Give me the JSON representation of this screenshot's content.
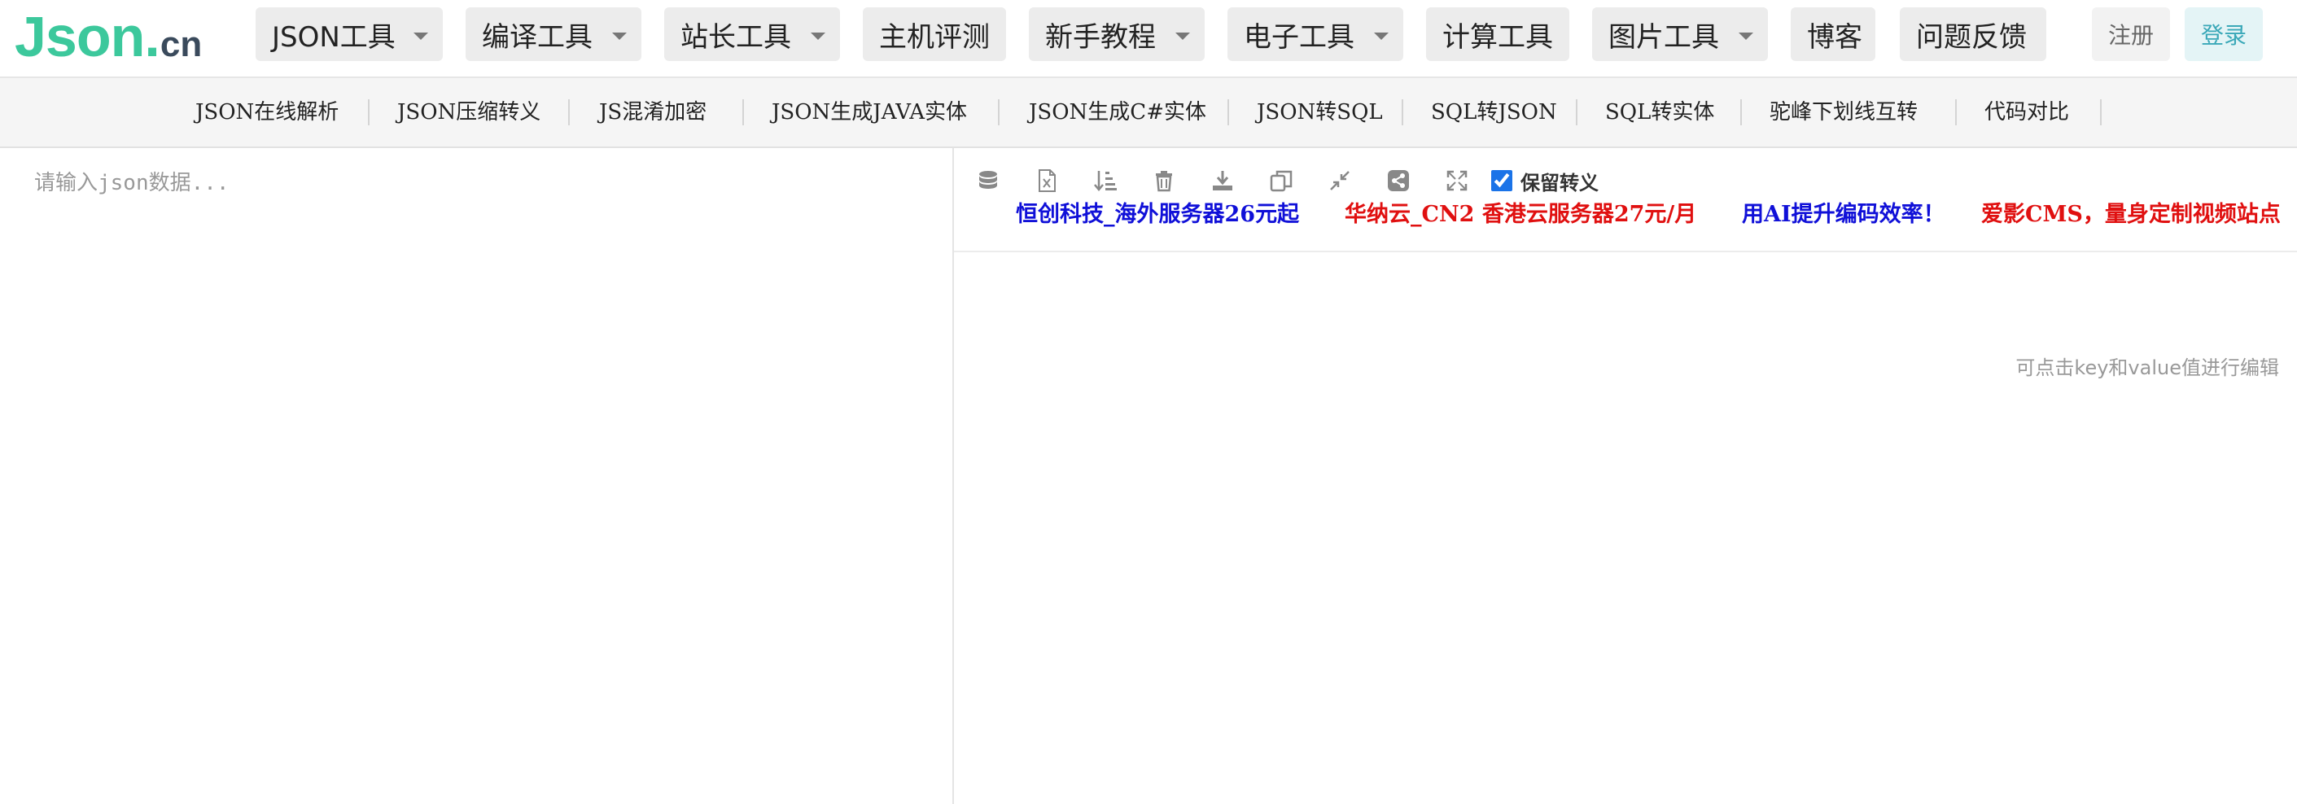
{
  "logo": {
    "main": "Json",
    "dot": ".",
    "suffix": "cn"
  },
  "nav": {
    "items": [
      {
        "label": "JSON工具",
        "dropdown": true
      },
      {
        "label": "编译工具",
        "dropdown": true
      },
      {
        "label": "站长工具",
        "dropdown": true
      },
      {
        "label": "主机评测",
        "dropdown": false
      },
      {
        "label": "新手教程",
        "dropdown": true
      },
      {
        "label": "电子工具",
        "dropdown": true
      },
      {
        "label": "计算工具",
        "dropdown": false
      },
      {
        "label": "图片工具",
        "dropdown": true
      },
      {
        "label": "博客",
        "dropdown": false
      },
      {
        "label": "问题反馈",
        "dropdown": false
      }
    ],
    "register": "注册",
    "login": "登录"
  },
  "subnav": {
    "items": [
      "JSON在线解析",
      "JSON压缩转义",
      "JS混淆加密",
      "JSON生成JAVA实体",
      "JSON生成C#实体",
      "JSON转SQL",
      "SQL转JSON",
      "SQL转实体",
      "驼峰下划线互转",
      "代码对比"
    ]
  },
  "editor": {
    "placeholder": "请输入json数据..."
  },
  "toolbar": {
    "icons": [
      "database-icon",
      "excel-file-icon",
      "sort-icon",
      "trash-icon",
      "download-icon",
      "copy-icon",
      "compress-icon",
      "share-icon",
      "fullscreen-icon"
    ],
    "keep_escape_label": "保留转义",
    "keep_escape_checked": true
  },
  "ads": [
    {
      "text": "恒创科技_海外服务器26元起",
      "color": "#1010d8"
    },
    {
      "text": "华纳云_CN2 香港云服务器27元/月",
      "color": "#e01010"
    },
    {
      "text": "用AI提升编码效率！",
      "color": "#1010d8"
    },
    {
      "text": "爱影CMS，量身定制视频站点",
      "color": "#e01010"
    }
  ],
  "hint": "可点击key和value值进行编辑",
  "colors": {
    "brand": "#3cc89c",
    "login": "#3aa8b8"
  }
}
